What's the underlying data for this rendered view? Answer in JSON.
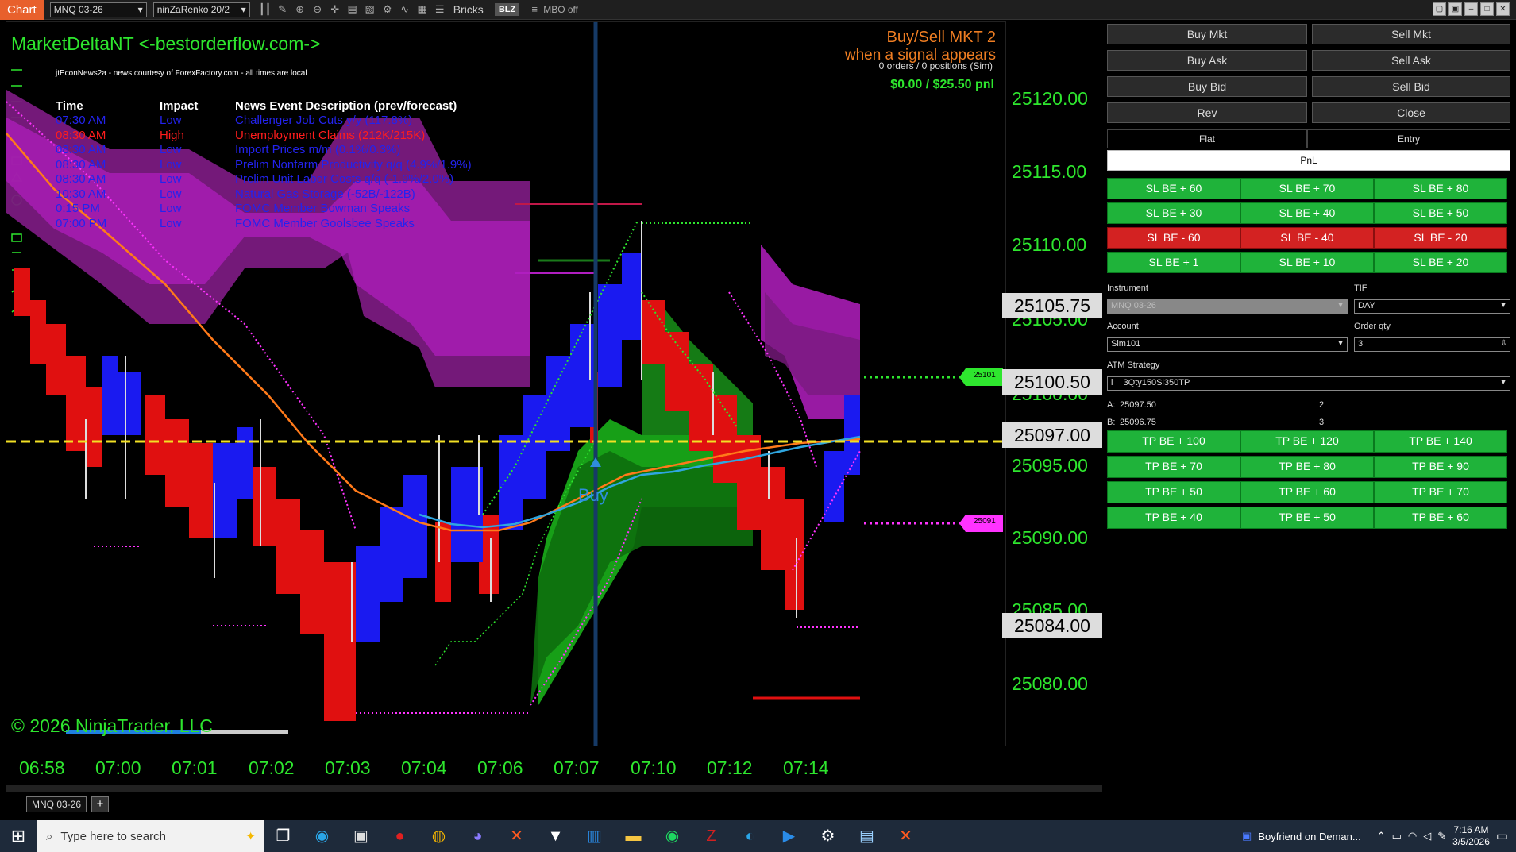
{
  "toolbar": {
    "chart_label": "Chart",
    "instrument": "MNQ 03-26",
    "bar_type": "ninZaRenko 20/2",
    "bricks": "Bricks",
    "blz": "BLZ",
    "mbo": "MBO off"
  },
  "chart": {
    "title": "MarketDeltaNT <-bestorderflow.com->",
    "news_source": "jtEconNews2a - news courtesy of ForexFactory.com - all times are local",
    "news_headers": {
      "time": "Time",
      "impact": "Impact",
      "description": "News Event Description (prev/forecast)"
    },
    "news": [
      {
        "time": "07:30 AM",
        "impact": "Low",
        "desc": "Challenger Job Cuts y/y (117.8%)",
        "level": "low"
      },
      {
        "time": "08:30 AM",
        "impact": "High",
        "desc": "Unemployment Claims (212K/215K)",
        "level": "high"
      },
      {
        "time": "08:30 AM",
        "impact": "Low",
        "desc": "Import Prices m/m (0.1%/0.3%)",
        "level": "low"
      },
      {
        "time": "08:30 AM",
        "impact": "Low",
        "desc": "Prelim Nonfarm Productivity q/q (4.9%/1.9%)",
        "level": "low"
      },
      {
        "time": "08:30 AM",
        "impact": "Low",
        "desc": "Prelim Unit Labor Costs q/q (-1.9%/2.0%)",
        "level": "low"
      },
      {
        "time": "10:30 AM",
        "impact": "Low",
        "desc": "Natural Gas Storage (-52B/-122B)",
        "level": "low"
      },
      {
        "time": "0:15 PM",
        "impact": "Low",
        "desc": "FOMC Member Bowman Speaks",
        "level": "low"
      },
      {
        "time": "07:00 PM",
        "impact": "Low",
        "desc": "FOMC Member Goolsbee Speaks",
        "level": "low"
      }
    ],
    "buysell_title": "Buy/Sell MKT 2",
    "buysell_sub": "when a signal appears",
    "orders": "0 orders / 0 positions (Sim)",
    "pnl": "$0.00 / $25.50 pnl",
    "buy_label": "Buy",
    "copyright": "© 2026 NinjaTrader, LLC",
    "green_marker": "25101",
    "magenta_marker": "25091"
  },
  "price_axis": {
    "labels": [
      "25120.00",
      "25115.00",
      "25110.00",
      "25105.00",
      "25100.00",
      "25095.00",
      "25090.00",
      "25085.00",
      "25080.00"
    ],
    "boxes": [
      "25105.75",
      "25100.50",
      "25097.00",
      "25084.00"
    ]
  },
  "time_axis": {
    "labels": [
      "06:58",
      "07:00",
      "07:01",
      "07:02",
      "07:03",
      "07:04",
      "07:06",
      "07:07",
      "07:10",
      "07:12",
      "07:14"
    ]
  },
  "panel": {
    "buy_mkt": "Buy Mkt",
    "sell_mkt": "Sell Mkt",
    "buy_ask": "Buy Ask",
    "sell_ask": "Sell Ask",
    "buy_bid": "Buy Bid",
    "sell_bid": "Sell Bid",
    "rev": "Rev",
    "close": "Close",
    "flat": "Flat",
    "entry": "Entry",
    "pnl": "PnL",
    "sl_rows": [
      [
        {
          "l": "SL BE + 60",
          "c": "green"
        },
        {
          "l": "SL BE + 70",
          "c": "green"
        },
        {
          "l": "SL BE + 80",
          "c": "green"
        }
      ],
      [
        {
          "l": "SL BE + 30",
          "c": "green"
        },
        {
          "l": "SL BE + 40",
          "c": "green"
        },
        {
          "l": "SL BE + 50",
          "c": "green"
        }
      ],
      [
        {
          "l": "SL BE - 60",
          "c": "red"
        },
        {
          "l": "SL BE - 40",
          "c": "red"
        },
        {
          "l": "SL BE - 20",
          "c": "red"
        }
      ],
      [
        {
          "l": "SL BE + 1",
          "c": "green"
        },
        {
          "l": "SL BE + 10",
          "c": "green"
        },
        {
          "l": "SL BE + 20",
          "c": "green"
        }
      ]
    ],
    "instrument_label": "Instrument",
    "instrument_value": "MNQ 03-26",
    "tif_label": "TIF",
    "tif_value": "DAY",
    "account_label": "Account",
    "account_value": "Sim101",
    "qty_label": "Order qty",
    "qty_value": "3",
    "atm_label": "ATM Strategy",
    "atm_value": "3Qty150Sl350TP",
    "ask_label": "A:",
    "ask_price": "25097.50",
    "ask_size": "2",
    "bid_label": "B:",
    "bid_price": "25096.75",
    "bid_size": "3",
    "tp_rows": [
      [
        "TP BE + 100",
        "TP BE + 120",
        "TP BE + 140"
      ],
      [
        "TP BE + 70",
        "TP BE + 80",
        "TP BE + 90"
      ],
      [
        "TP BE + 50",
        "TP BE + 60",
        "TP BE + 70"
      ],
      [
        "TP BE + 40",
        "TP BE + 50",
        "TP BE + 60"
      ]
    ]
  },
  "tab": {
    "label": "MNQ 03-26",
    "add": "+"
  },
  "taskbar": {
    "search_placeholder": "Type here to search",
    "media": "Boyfriend on Deman...",
    "time": "7:16 AM",
    "date": "3/5/2026"
  }
}
